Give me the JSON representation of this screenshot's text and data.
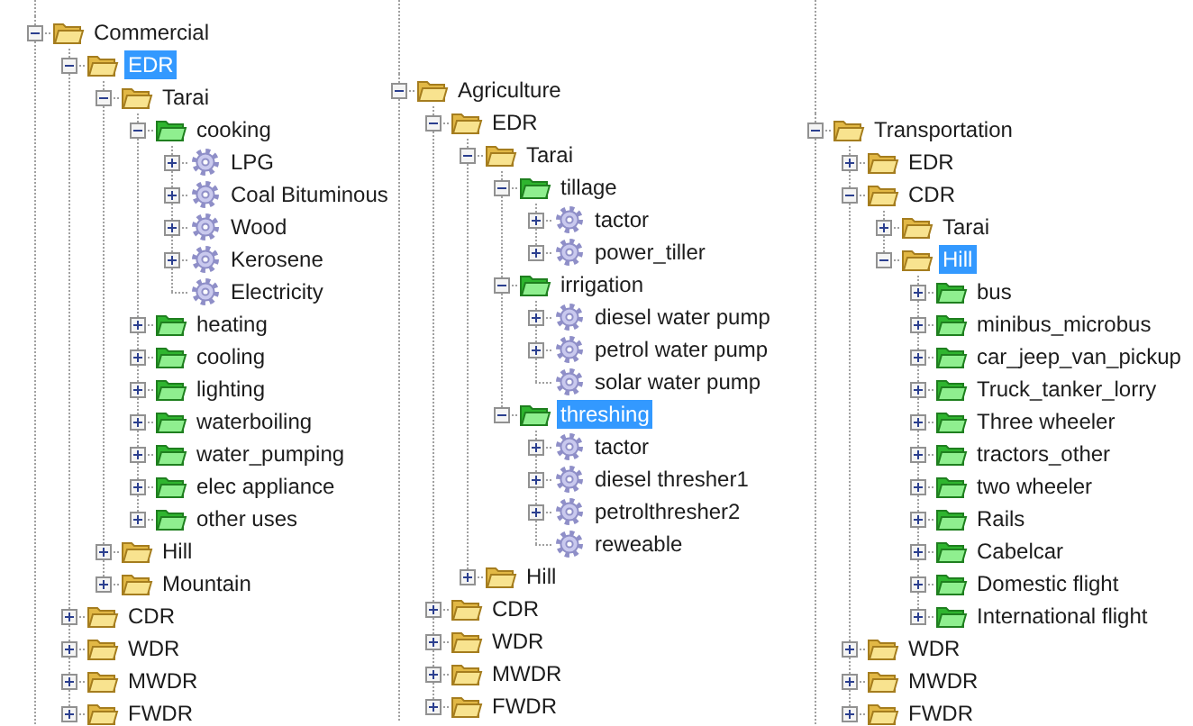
{
  "trees": [
    {
      "nodes": [
        {
          "label": "Commercial",
          "kind": "folder",
          "expanded": true,
          "selected": false,
          "children": [
            {
              "label": "EDR",
              "kind": "folder",
              "expanded": true,
              "selected": true,
              "children": [
                {
                  "label": "Tarai",
                  "kind": "folder",
                  "expanded": true,
                  "selected": false,
                  "children": [
                    {
                      "label": "cooking",
                      "kind": "category",
                      "expanded": true,
                      "selected": false,
                      "children": [
                        {
                          "label": "LPG",
                          "kind": "item",
                          "expanded": false,
                          "selected": false
                        },
                        {
                          "label": "Coal Bituminous",
                          "kind": "item",
                          "expanded": false,
                          "selected": false
                        },
                        {
                          "label": "Wood",
                          "kind": "item",
                          "expanded": false,
                          "selected": false
                        },
                        {
                          "label": "Kerosene",
                          "kind": "item",
                          "expanded": false,
                          "selected": false
                        },
                        {
                          "label": "Electricity",
                          "kind": "item",
                          "selected": false
                        }
                      ]
                    },
                    {
                      "label": "heating",
                      "kind": "category",
                      "expanded": false,
                      "selected": false
                    },
                    {
                      "label": "cooling",
                      "kind": "category",
                      "expanded": false,
                      "selected": false
                    },
                    {
                      "label": "lighting",
                      "kind": "category",
                      "expanded": false,
                      "selected": false
                    },
                    {
                      "label": "waterboiling",
                      "kind": "category",
                      "expanded": false,
                      "selected": false
                    },
                    {
                      "label": "water_pumping",
                      "kind": "category",
                      "expanded": false,
                      "selected": false
                    },
                    {
                      "label": "elec appliance",
                      "kind": "category",
                      "expanded": false,
                      "selected": false
                    },
                    {
                      "label": "other uses",
                      "kind": "category",
                      "expanded": false,
                      "selected": false
                    }
                  ]
                },
                {
                  "label": "Hill",
                  "kind": "folder",
                  "expanded": false,
                  "selected": false
                },
                {
                  "label": "Mountain",
                  "kind": "folder",
                  "expanded": false,
                  "selected": false
                }
              ]
            },
            {
              "label": "CDR",
              "kind": "folder",
              "expanded": false,
              "selected": false
            },
            {
              "label": "WDR",
              "kind": "folder",
              "expanded": false,
              "selected": false
            },
            {
              "label": "MWDR",
              "kind": "folder",
              "expanded": false,
              "selected": false
            },
            {
              "label": "FWDR",
              "kind": "folder",
              "expanded": false,
              "selected": false
            }
          ]
        }
      ]
    },
    {
      "nodes": [
        {
          "label": "Agriculture",
          "kind": "folder",
          "expanded": true,
          "selected": false,
          "children": [
            {
              "label": "EDR",
              "kind": "folder",
              "expanded": true,
              "selected": false,
              "children": [
                {
                  "label": "Tarai",
                  "kind": "folder",
                  "expanded": true,
                  "selected": false,
                  "children": [
                    {
                      "label": "tillage",
                      "kind": "category",
                      "expanded": true,
                      "selected": false,
                      "children": [
                        {
                          "label": "tactor",
                          "kind": "item",
                          "expanded": false,
                          "selected": false
                        },
                        {
                          "label": "power_tiller",
                          "kind": "item",
                          "expanded": false,
                          "selected": false
                        }
                      ]
                    },
                    {
                      "label": "irrigation",
                      "kind": "category",
                      "expanded": true,
                      "selected": false,
                      "children": [
                        {
                          "label": "diesel water pump",
                          "kind": "item",
                          "expanded": false,
                          "selected": false
                        },
                        {
                          "label": "petrol water pump",
                          "kind": "item",
                          "expanded": false,
                          "selected": false
                        },
                        {
                          "label": "solar water pump",
                          "kind": "item",
                          "selected": false
                        }
                      ]
                    },
                    {
                      "label": "threshing",
                      "kind": "category",
                      "expanded": true,
                      "selected": true,
                      "children": [
                        {
                          "label": "tactor",
                          "kind": "item",
                          "expanded": false,
                          "selected": false
                        },
                        {
                          "label": "diesel thresher1",
                          "kind": "item",
                          "expanded": false,
                          "selected": false
                        },
                        {
                          "label": "petrolthresher2",
                          "kind": "item",
                          "expanded": false,
                          "selected": false
                        },
                        {
                          "label": "reweable",
                          "kind": "item",
                          "selected": false
                        }
                      ]
                    }
                  ]
                },
                {
                  "label": "Hill",
                  "kind": "folder",
                  "expanded": false,
                  "selected": false
                }
              ]
            },
            {
              "label": "CDR",
              "kind": "folder",
              "expanded": false,
              "selected": false
            },
            {
              "label": "WDR",
              "kind": "folder",
              "expanded": false,
              "selected": false
            },
            {
              "label": "MWDR",
              "kind": "folder",
              "expanded": false,
              "selected": false
            },
            {
              "label": "FWDR",
              "kind": "folder",
              "expanded": false,
              "selected": false
            }
          ]
        }
      ]
    },
    {
      "nodes": [
        {
          "label": "Transportation",
          "kind": "folder",
          "expanded": true,
          "selected": false,
          "children": [
            {
              "label": "EDR",
              "kind": "folder",
              "expanded": false,
              "selected": false
            },
            {
              "label": "CDR",
              "kind": "folder",
              "expanded": true,
              "selected": false,
              "children": [
                {
                  "label": "Tarai",
                  "kind": "folder",
                  "expanded": false,
                  "selected": false
                },
                {
                  "label": "Hill",
                  "kind": "folder",
                  "expanded": true,
                  "selected": true,
                  "children": [
                    {
                      "label": "bus",
                      "kind": "category",
                      "expanded": false,
                      "selected": false
                    },
                    {
                      "label": "minibus_microbus",
                      "kind": "category",
                      "expanded": false,
                      "selected": false
                    },
                    {
                      "label": "car_jeep_van_pickup",
                      "kind": "category",
                      "expanded": false,
                      "selected": false
                    },
                    {
                      "label": "Truck_tanker_lorry",
                      "kind": "category",
                      "expanded": false,
                      "selected": false
                    },
                    {
                      "label": "Three wheeler",
                      "kind": "category",
                      "expanded": false,
                      "selected": false
                    },
                    {
                      "label": "tractors_other",
                      "kind": "category",
                      "expanded": false,
                      "selected": false
                    },
                    {
                      "label": "two wheeler",
                      "kind": "category",
                      "expanded": false,
                      "selected": false
                    },
                    {
                      "label": "Rails",
                      "kind": "category",
                      "expanded": false,
                      "selected": false
                    },
                    {
                      "label": "Cabelcar",
                      "kind": "category",
                      "expanded": false,
                      "selected": false
                    },
                    {
                      "label": "Domestic flight",
                      "kind": "category",
                      "expanded": false,
                      "selected": false
                    },
                    {
                      "label": "International flight",
                      "kind": "category",
                      "expanded": false,
                      "selected": false
                    }
                  ]
                }
              ]
            },
            {
              "label": "WDR",
              "kind": "folder",
              "expanded": false,
              "selected": false
            },
            {
              "label": "MWDR",
              "kind": "folder",
              "expanded": false,
              "selected": false
            },
            {
              "label": "FWDR",
              "kind": "folder",
              "expanded": false,
              "selected": false
            }
          ]
        }
      ]
    }
  ]
}
